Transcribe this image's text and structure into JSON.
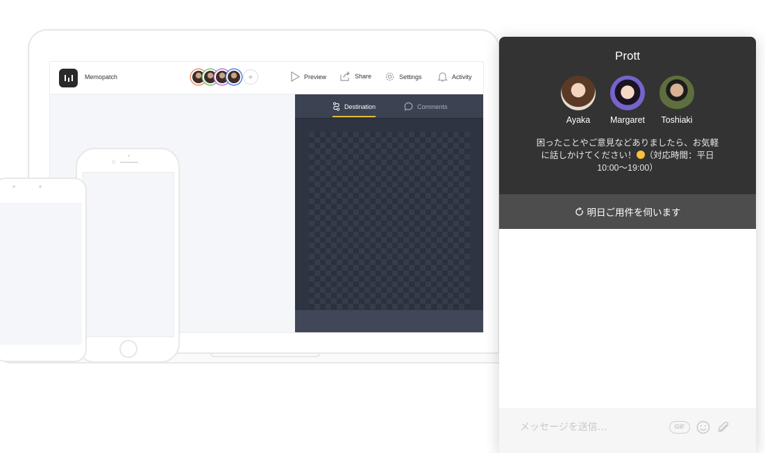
{
  "background_app": {
    "app_name": "Memopatch",
    "header_menu": {
      "preview_label": "Preview",
      "share_label": "Share",
      "settings_label": "Settings",
      "activity_label": "Activity"
    },
    "add_member_glyph": "+",
    "collaborator_ring_colors": [
      "#f08a5d",
      "#6cc070",
      "#c46bd6",
      "#4a78e0"
    ],
    "panel_tabs": [
      {
        "label": "Destination",
        "icon": "route-icon",
        "active": true
      },
      {
        "label": "Comments",
        "icon": "comment-bubble-icon",
        "active": false
      }
    ],
    "accent_color": "#e5b83a"
  },
  "chat_widget": {
    "title": "Prott",
    "team": [
      {
        "name": "Ayaka"
      },
      {
        "name": "Margaret"
      },
      {
        "name": "Toshiaki"
      }
    ],
    "welcome_message_before_emoji": "困ったことやご意見などありましたら、お気軽に話しかけてください！",
    "welcome_message_after_emoji": "（対応時間：平日10:00〜19:00）",
    "reply_time": {
      "icon": "clock-icon",
      "text": "明日ご用件を伺います"
    },
    "composer": {
      "placeholder": "メッセージを送信…",
      "gif_label": "GIF",
      "emoji_icon": "smiley-icon",
      "attach_icon": "paperclip-icon"
    },
    "colors": {
      "header_bg": "#333333",
      "reply_bar_bg": "#4d4d4d"
    }
  }
}
